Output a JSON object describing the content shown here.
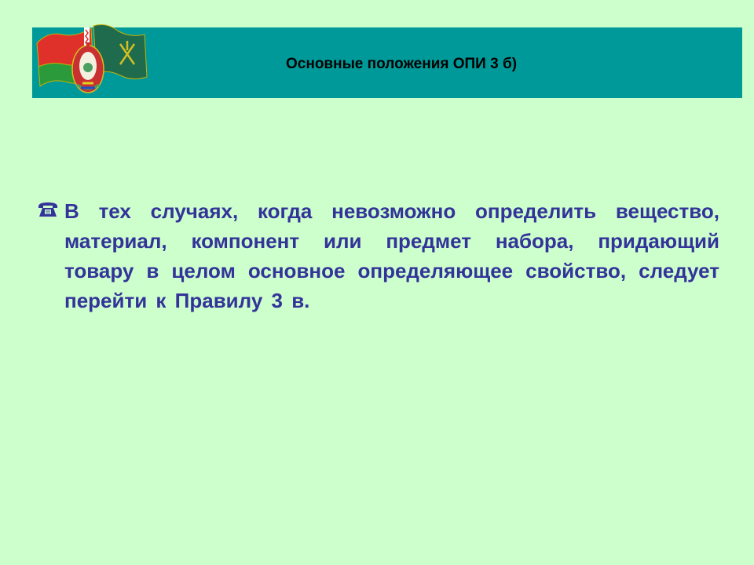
{
  "header": {
    "title": "Основные положения ОПИ 3 б)",
    "background_color": "#009999",
    "emblem": "belarus-flags-and-coat-of-arms-icon"
  },
  "content": {
    "bullet_icon": "telephone-icon",
    "paragraph": "В тех случаях, когда невозможно определить вещество, материал, компонент или предмет набора, придающий товару в целом основное определяющее свойство, следует перейти к Правилу 3 в.",
    "text_color": "#333399"
  },
  "page": {
    "background_color": "#ccffcc"
  }
}
